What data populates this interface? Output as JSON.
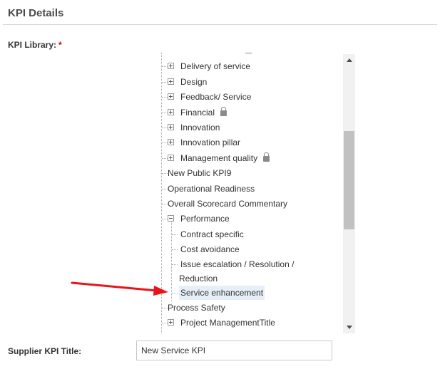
{
  "section": {
    "title": "KPI Details"
  },
  "kpi_library": {
    "label": "KPI Library:",
    "required_marker": "*",
    "tree": [
      {
        "label": "Delivery of service",
        "expander": "plus"
      },
      {
        "label": "Design",
        "expander": "plus"
      },
      {
        "label": "Feedback/ Service",
        "expander": "plus"
      },
      {
        "label": "Financial",
        "expander": "plus",
        "locked": true,
        "icon": "lock-icon"
      },
      {
        "label": "Innovation",
        "expander": "plus"
      },
      {
        "label": "Innovation pillar",
        "expander": "plus"
      },
      {
        "label": "Management quality",
        "expander": "plus",
        "locked": true,
        "icon": "lock-icon"
      },
      {
        "label": "New Public KPI9"
      },
      {
        "label": "Operational Readiness"
      },
      {
        "label": "Overall Scorecard Commentary"
      },
      {
        "label": "Performance",
        "expander": "minus",
        "expanded": true,
        "children": [
          {
            "label": "Contract specific"
          },
          {
            "label": "Cost avoidance"
          },
          {
            "label": "Issue escalation / Resolution /",
            "label_line2": "Reduction"
          },
          {
            "label": "Service enhancement",
            "highlighted": true
          }
        ]
      },
      {
        "label": "Process Safety"
      },
      {
        "label": "Project ManagementTitle",
        "expander": "plus"
      }
    ]
  },
  "supplier_kpi": {
    "label": "Supplier KPI Title:",
    "value": "New Service KPI"
  },
  "colors": {
    "annotation_arrow": "#e8141b",
    "highlight": "#e6eef8"
  }
}
